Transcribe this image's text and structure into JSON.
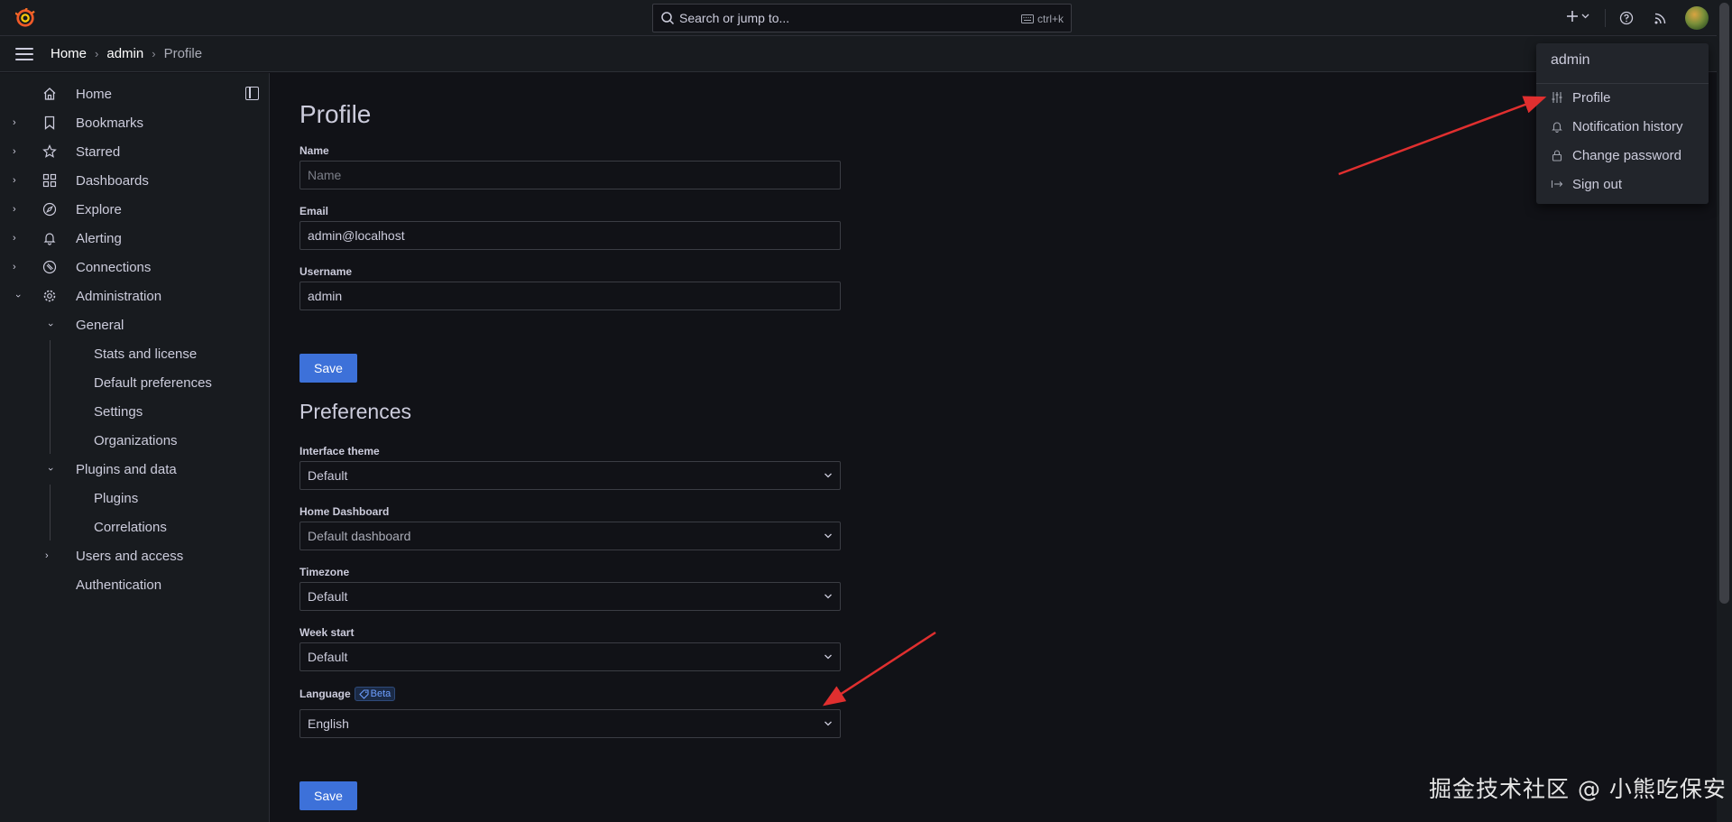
{
  "topbar": {
    "search_placeholder": "Search or jump to...",
    "search_shortcut": "ctrl+k"
  },
  "breadcrumbs": [
    "Home",
    "admin",
    "Profile"
  ],
  "sidebar": {
    "items": [
      {
        "label": "Home",
        "icon": "home-icon",
        "expandable": false
      },
      {
        "label": "Bookmarks",
        "icon": "bookmark-icon",
        "expandable": true
      },
      {
        "label": "Starred",
        "icon": "star-icon",
        "expandable": true
      },
      {
        "label": "Dashboards",
        "icon": "apps-icon",
        "expandable": true
      },
      {
        "label": "Explore",
        "icon": "compass-icon",
        "expandable": true
      },
      {
        "label": "Alerting",
        "icon": "bell-icon",
        "expandable": true
      },
      {
        "label": "Connections",
        "icon": "link-icon",
        "expandable": true
      },
      {
        "label": "Administration",
        "icon": "cog-icon",
        "expandable": true,
        "expanded": true
      }
    ],
    "admin_children": {
      "general": "General",
      "general_items": [
        "Stats and license",
        "Default preferences",
        "Settings",
        "Organizations"
      ],
      "plugins_and_data": "Plugins and data",
      "plugins_items": [
        "Plugins",
        "Correlations"
      ],
      "users_and_access": "Users and access",
      "authentication": "Authentication"
    }
  },
  "profile": {
    "title": "Profile",
    "name_label": "Name",
    "name_placeholder": "Name",
    "email_label": "Email",
    "email_value": "admin@localhost",
    "username_label": "Username",
    "username_value": "admin",
    "save_label": "Save"
  },
  "preferences": {
    "title": "Preferences",
    "theme_label": "Interface theme",
    "theme_value": "Default",
    "home_dashboard_label": "Home Dashboard",
    "home_dashboard_value": "Default dashboard",
    "timezone_label": "Timezone",
    "timezone_value": "Default",
    "week_start_label": "Week start",
    "week_start_value": "Default",
    "language_label": "Language",
    "language_badge": "Beta",
    "language_value": "English",
    "save_label": "Save"
  },
  "user_menu": {
    "header": "admin",
    "items": [
      {
        "label": "Profile",
        "icon": "sliders-icon"
      },
      {
        "label": "Notification history",
        "icon": "bell-icon"
      },
      {
        "label": "Change password",
        "icon": "lock-icon"
      },
      {
        "label": "Sign out",
        "icon": "sign-out-icon"
      }
    ]
  },
  "watermark": "掘金技术社区 @ 小熊吃保安",
  "colors": {
    "background": "#111217",
    "panel": "#181b1f",
    "primary_button": "#3d71d9",
    "annotation_arrow": "#e02f2f"
  }
}
